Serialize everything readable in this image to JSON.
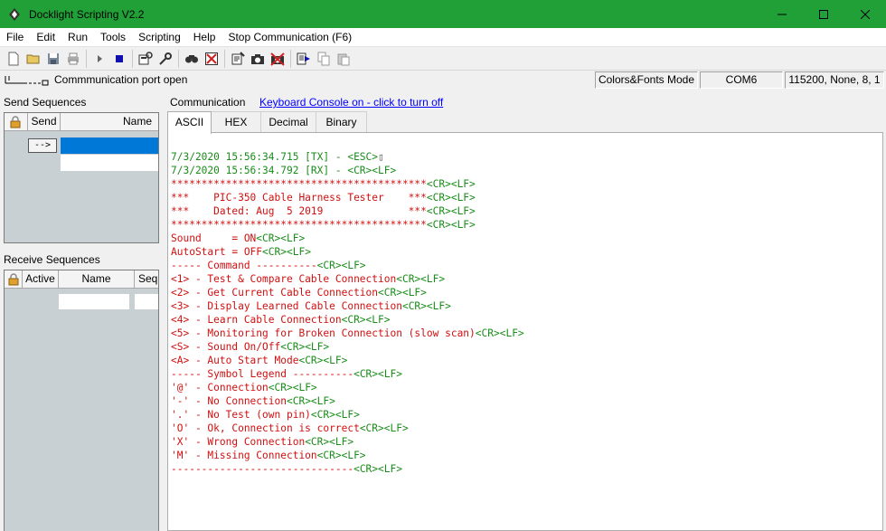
{
  "window": {
    "title": "Docklight Scripting V2.2"
  },
  "menu": [
    "File",
    "Edit",
    "Run",
    "Tools",
    "Scripting",
    "Help",
    "Stop Communication  (F6)"
  ],
  "toolbar": {
    "icons": [
      "new-file-icon",
      "open-folder-icon",
      "save-icon",
      "print-icon",
      "play-icon",
      "stop-icon",
      "port-settings-icon",
      "options-icon",
      "find-icon",
      "clear-icon",
      "edit-script-icon",
      "snapshot-icon",
      "stop-snapshot-icon",
      "run-script-icon",
      "copy-icon",
      "paste-icon"
    ]
  },
  "status": {
    "port_status": "Commmunication port open",
    "mode": "Colors&Fonts Mode",
    "port": "COM6",
    "settings": "115200, None, 8, 1"
  },
  "send_panel": {
    "label": "Send Sequences",
    "col_send": "Send",
    "col_name": "Name",
    "send_button": "-->"
  },
  "receive_panel": {
    "label": "Receive Sequences",
    "col_active": "Active",
    "col_name": "Name",
    "col_sequ": "Sequ"
  },
  "communication": {
    "label": "Communication",
    "keyboard_link": "Keyboard Console on - click to turn off",
    "tabs": [
      "ASCII",
      "HEX",
      "Decimal",
      "Binary"
    ],
    "active_tab": "ASCII"
  },
  "colors": {
    "title_bar": "#21a038",
    "received": "#d01010",
    "control": "#1a8c1a",
    "link": "#0000ff"
  },
  "console_lines": [
    [
      {
        "t": "7/3/2020 15:56:34.715 [TX] - <ESC>",
        "c": "green"
      },
      {
        "t": "▯",
        "c": "glyph"
      }
    ],
    [
      {
        "t": "7/3/2020 15:56:34.792 [RX] - <CR><LF>",
        "c": "green"
      }
    ],
    [
      {
        "t": "******************************************",
        "c": "red"
      },
      {
        "t": "<CR><LF>",
        "c": "green"
      }
    ],
    [
      {
        "t": "***    PIC-350 Cable Harness Tester    ***",
        "c": "red"
      },
      {
        "t": "<CR><LF>",
        "c": "green"
      }
    ],
    [
      {
        "t": "***    Dated: Aug  5 2019              ***",
        "c": "red"
      },
      {
        "t": "<CR><LF>",
        "c": "green"
      }
    ],
    [
      {
        "t": "******************************************",
        "c": "red"
      },
      {
        "t": "<CR><LF>",
        "c": "green"
      }
    ],
    [
      {
        "t": "Sound     = ON",
        "c": "red"
      },
      {
        "t": "<CR><LF>",
        "c": "green"
      }
    ],
    [
      {
        "t": "AutoStart = OFF",
        "c": "red"
      },
      {
        "t": "<CR><LF>",
        "c": "green"
      }
    ],
    [
      {
        "t": "----- Command ----------",
        "c": "red"
      },
      {
        "t": "<CR><LF>",
        "c": "green"
      }
    ],
    [
      {
        "t": "<1> - Test & Compare Cable Connection",
        "c": "red"
      },
      {
        "t": "<CR><LF>",
        "c": "green"
      }
    ],
    [
      {
        "t": "<2> - Get Current Cable Connection",
        "c": "red"
      },
      {
        "t": "<CR><LF>",
        "c": "green"
      }
    ],
    [
      {
        "t": "<3> - Display Learned Cable Connection",
        "c": "red"
      },
      {
        "t": "<CR><LF>",
        "c": "green"
      }
    ],
    [
      {
        "t": "<4> - Learn Cable Connection",
        "c": "red"
      },
      {
        "t": "<CR><LF>",
        "c": "green"
      }
    ],
    [
      {
        "t": "<5> - Monitoring for Broken Connection (slow scan)",
        "c": "red"
      },
      {
        "t": "<CR><LF>",
        "c": "green"
      }
    ],
    [
      {
        "t": "<S> - Sound On/Off",
        "c": "red"
      },
      {
        "t": "<CR><LF>",
        "c": "green"
      }
    ],
    [
      {
        "t": "<A> - Auto Start Mode",
        "c": "red"
      },
      {
        "t": "<CR><LF>",
        "c": "green"
      }
    ],
    [
      {
        "t": "----- Symbol Legend ----------",
        "c": "red"
      },
      {
        "t": "<CR><LF>",
        "c": "green"
      }
    ],
    [
      {
        "t": "'@' - Connection",
        "c": "red"
      },
      {
        "t": "<CR><LF>",
        "c": "green"
      }
    ],
    [
      {
        "t": "'-' - No Connection",
        "c": "red"
      },
      {
        "t": "<CR><LF>",
        "c": "green"
      }
    ],
    [
      {
        "t": "'.' - No Test (own pin)",
        "c": "red"
      },
      {
        "t": "<CR><LF>",
        "c": "green"
      }
    ],
    [
      {
        "t": "'O' - Ok, Connection is correct",
        "c": "red"
      },
      {
        "t": "<CR><LF>",
        "c": "green"
      }
    ],
    [
      {
        "t": "'X' - Wrong Connection",
        "c": "red"
      },
      {
        "t": "<CR><LF>",
        "c": "green"
      }
    ],
    [
      {
        "t": "'M' - Missing Connection",
        "c": "red"
      },
      {
        "t": "<CR><LF>",
        "c": "green"
      }
    ],
    [
      {
        "t": "------------------------------",
        "c": "red"
      },
      {
        "t": "<CR><LF>",
        "c": "green"
      }
    ]
  ]
}
